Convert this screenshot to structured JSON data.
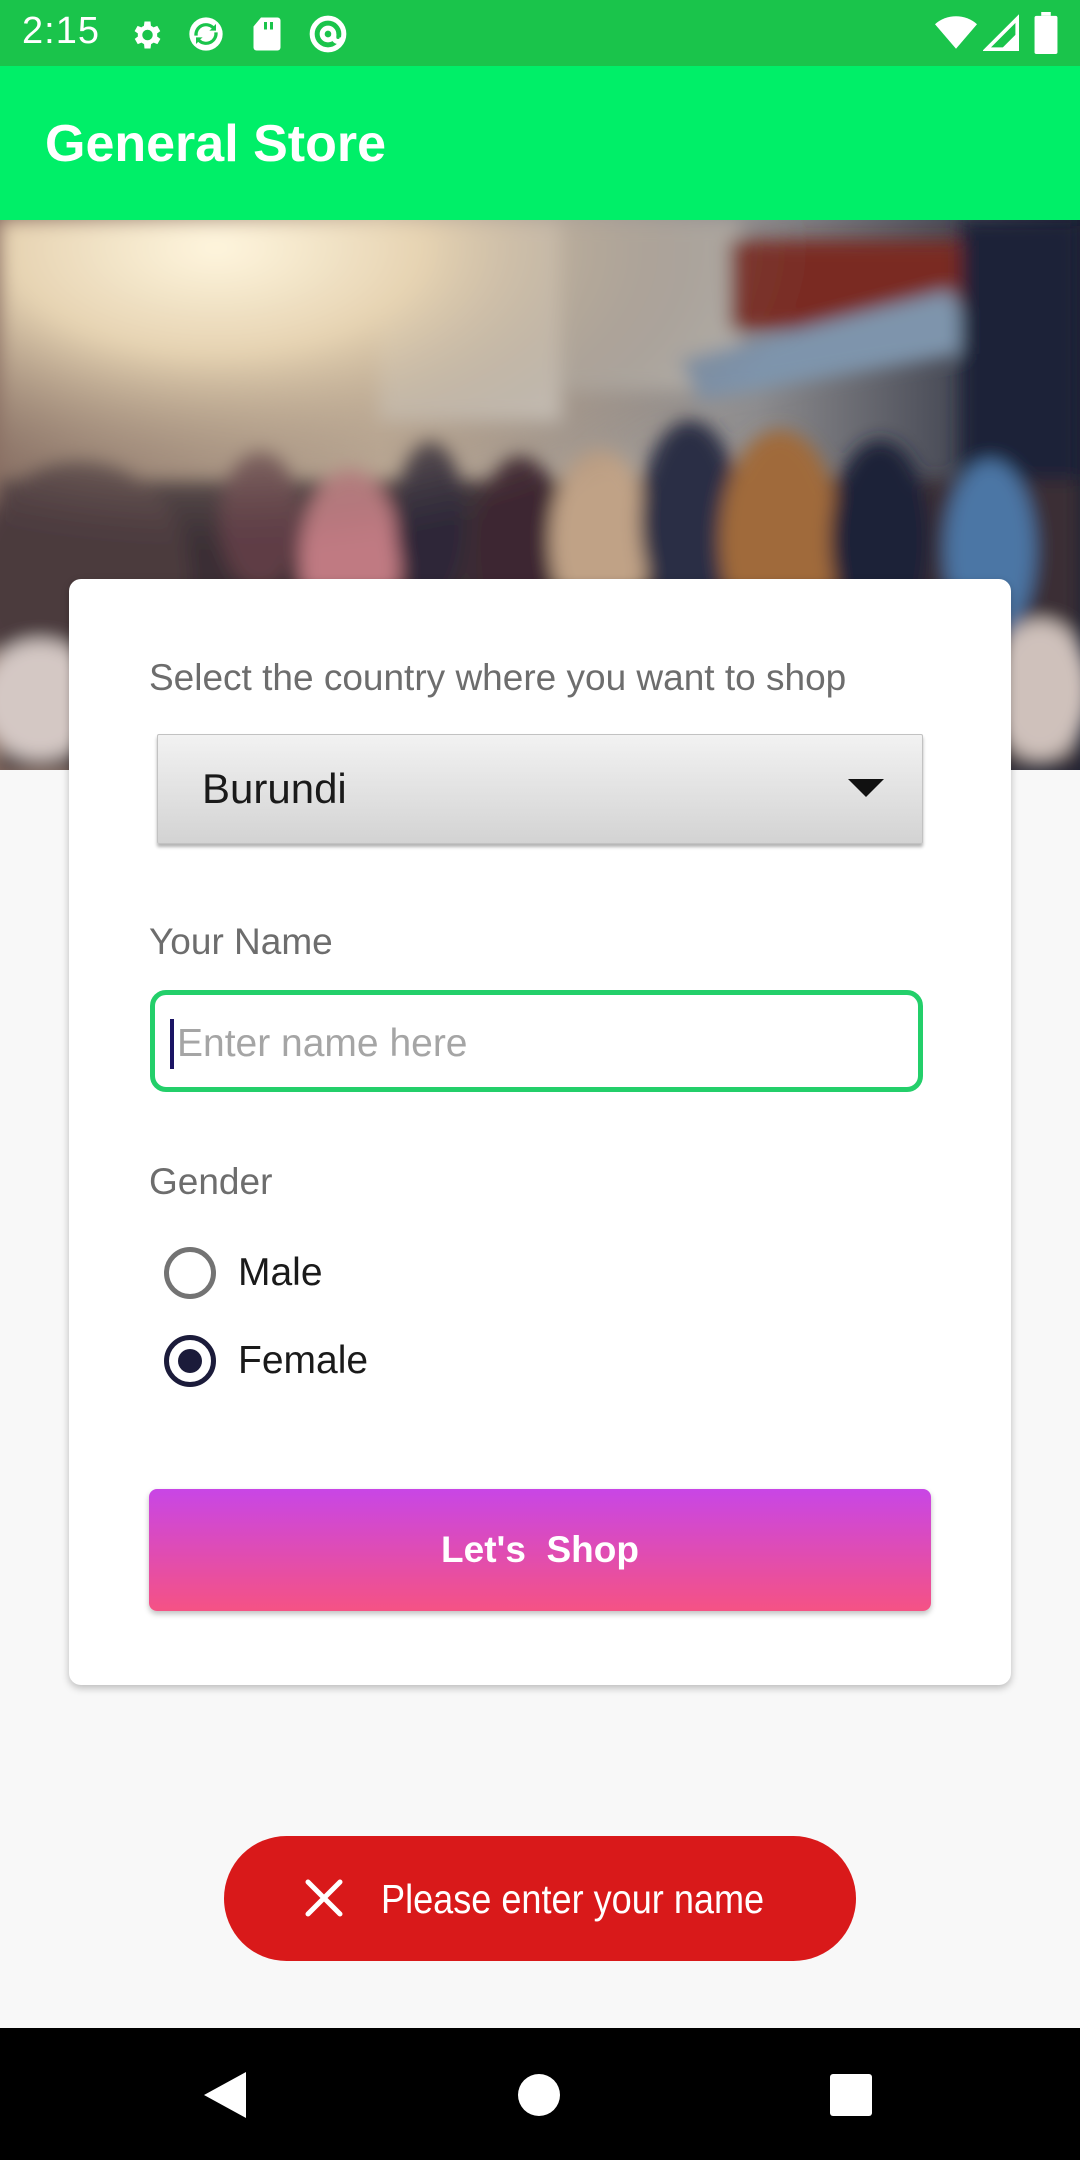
{
  "status_bar": {
    "time": "2:15",
    "left_icons": [
      "gear-icon",
      "sync-icon",
      "sd-card-icon",
      "at-sign-icon"
    ],
    "right_icons": [
      "wifi-icon",
      "cell-signal-icon",
      "battery-icon"
    ]
  },
  "app_bar": {
    "title": "General Store",
    "color": "#00ef68"
  },
  "hero": {
    "image": "blurred-crowded-street-photo"
  },
  "form": {
    "country_label": "Select the country where you want to shop",
    "country_selected": "Burundi",
    "name_label": "Your Name",
    "name_value": "",
    "name_placeholder": "Enter name here",
    "gender_label": "Gender",
    "gender_options": [
      {
        "label": "Male",
        "selected": false
      },
      {
        "label": "Female",
        "selected": true
      }
    ],
    "submit_label": "Let's  Shop"
  },
  "toast": {
    "icon": "close-icon",
    "message": "Please enter your name",
    "color": "#d9191a"
  },
  "nav_bar": {
    "buttons": [
      "back-icon",
      "home-icon",
      "recents-icon"
    ]
  }
}
